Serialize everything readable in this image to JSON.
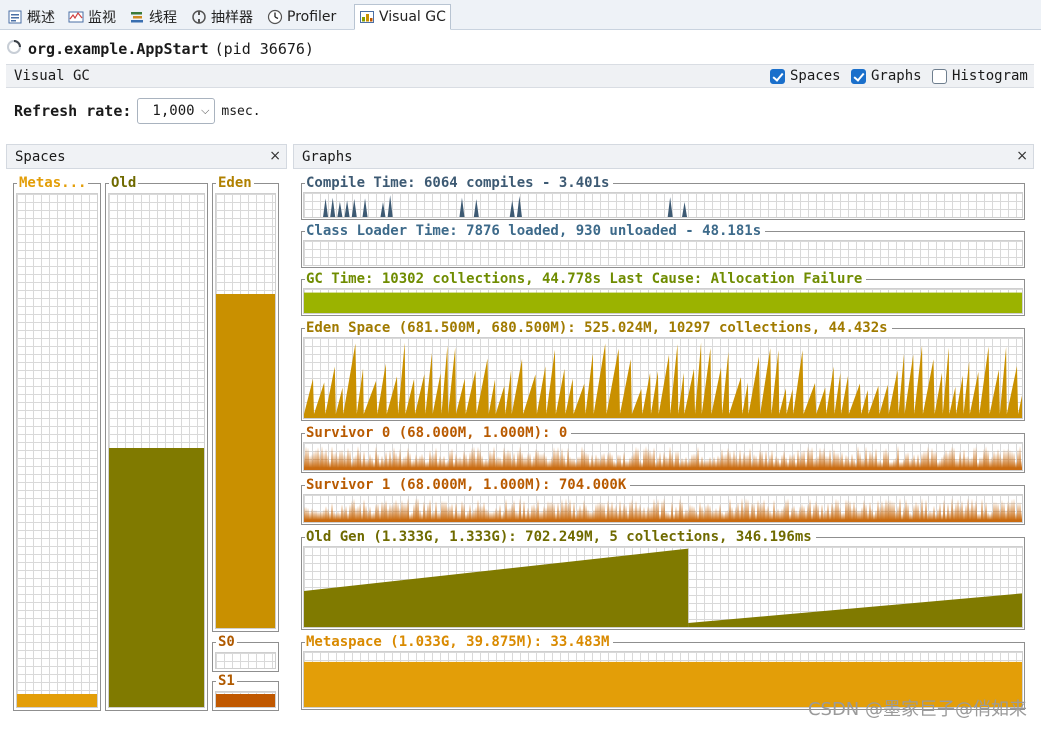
{
  "tabs": [
    {
      "label": "概述",
      "icon": "overview-icon"
    },
    {
      "label": "监视",
      "icon": "monitor-icon"
    },
    {
      "label": "线程",
      "icon": "threads-icon"
    },
    {
      "label": "抽样器",
      "icon": "sampler-icon"
    },
    {
      "label": "Profiler",
      "icon": "profiler-icon"
    },
    {
      "label": "Visual GC",
      "icon": "visual-gc-icon",
      "active": true
    }
  ],
  "app": {
    "name": "org.example.AppStart",
    "pid": "(pid 36676)"
  },
  "vgc_bar": {
    "label": "Visual GC"
  },
  "options": [
    {
      "label": "Spaces",
      "checked": true
    },
    {
      "label": "Graphs",
      "checked": true
    },
    {
      "label": "Histogram",
      "checked": false
    }
  ],
  "refresh": {
    "label": "Refresh rate:",
    "value": "1,000",
    "unit": "msec."
  },
  "panels": {
    "spaces": "Spaces",
    "graphs": "Graphs",
    "close": "×"
  },
  "spaces": [
    {
      "label": "Metas...",
      "fill": 0.025,
      "color": "#e39e08",
      "label_color": "#e39e08"
    },
    {
      "label": "Old",
      "fill": 0.505,
      "color": "#807a00",
      "label_color": "#6f6a00"
    },
    {
      "label": "Eden",
      "fill": 0.77,
      "color": "#c99000",
      "label_color": "#b08000"
    },
    {
      "label": "S0",
      "fill": 0.0,
      "color": "#c96b00",
      "label_color": "#b05a00"
    },
    {
      "label": "S1",
      "fill": 0.9,
      "color": "#c05800",
      "label_color": "#b05a00"
    }
  ],
  "graphs": [
    {
      "title": "Compile Time: 6064 compiles - 3.401s",
      "color": "#3d5a73",
      "fill": "#3d5a73",
      "kind": "spikes"
    },
    {
      "title": "Class Loader Time: 7876 loaded, 930 unloaded - 48.181s",
      "color": "#3d6a8a",
      "fill": "#3d6a8a",
      "kind": "empty"
    },
    {
      "title": "GC Time: 10302 collections, 44.778s  Last Cause: Allocation Failure",
      "color": "#6f8c00",
      "fill": "#9bb300",
      "kind": "full",
      "level": 0.85
    },
    {
      "title": "Eden Space (681.500M, 680.500M): 525.024M, 10297 collections, 44.432s",
      "color": "#a07a00",
      "fill": "#c99000",
      "kind": "sawtooth"
    },
    {
      "title": "Survivor 0 (68.000M, 1.000M): 0",
      "color": "#b85a00",
      "fill": "#c96b10",
      "kind": "noise"
    },
    {
      "title": "Survivor 1 (68.000M, 1.000M): 704.000K",
      "color": "#b85a00",
      "fill": "#c96b10",
      "kind": "noise"
    },
    {
      "title": "Old Gen (1.333G, 1.333G): 702.249M, 5 collections, 346.196ms",
      "color": "#6f6a00",
      "fill": "#807a00",
      "kind": "ramp"
    },
    {
      "title": "Metaspace (1.033G, 39.875M): 33.483M",
      "color": "#d98a00",
      "fill": "#e39e08",
      "kind": "full",
      "level": 0.82
    }
  ],
  "watermark": "CSDN @墨家巨子@俏如来"
}
